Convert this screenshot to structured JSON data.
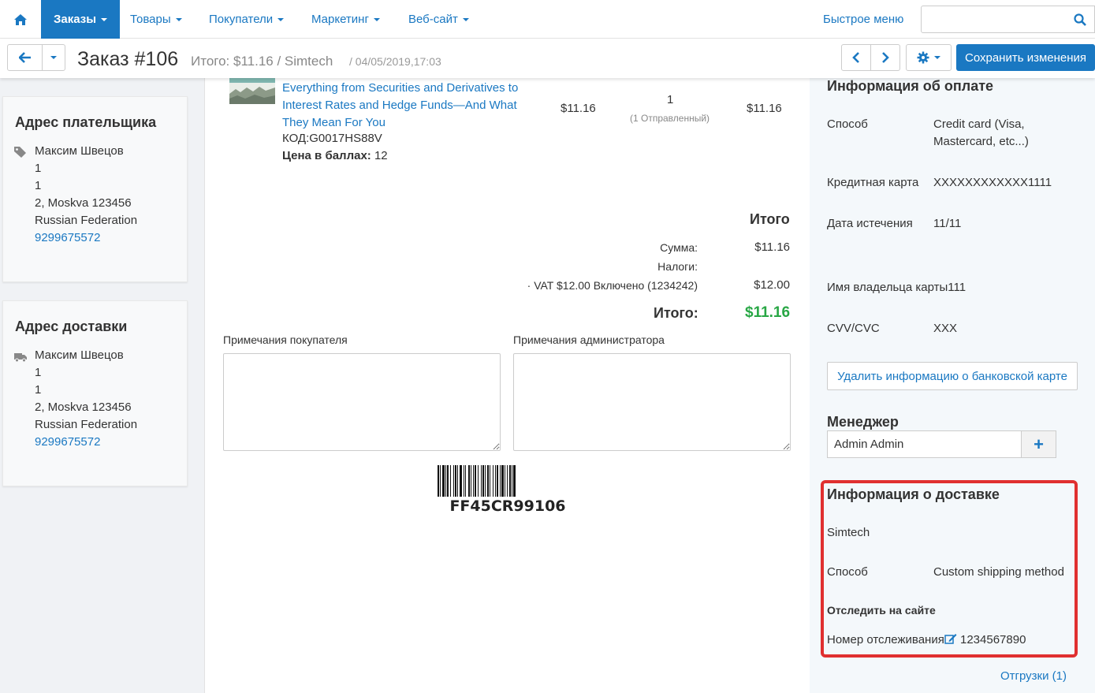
{
  "nav": {
    "items": [
      {
        "label": "Заказы"
      },
      {
        "label": "Товары"
      },
      {
        "label": "Покупатели"
      },
      {
        "label": "Маркетинг"
      },
      {
        "label": "Веб-сайт"
      }
    ],
    "quick_menu": "Быстрое меню",
    "search_placeholder": ""
  },
  "toolbar": {
    "title": "Заказ #106",
    "subtitle": "Итого: $11.16 / Simtech",
    "date": "/ 04/05/2019,17:03",
    "save_label": "Сохранить изменения"
  },
  "billing": {
    "title": "Адрес плательщика",
    "name": "Максим Швецов",
    "line1": "1",
    "line2": "1",
    "city": "2, Moskva 123456",
    "country": "Russian Federation",
    "phone": "9299675572"
  },
  "shipping_addr": {
    "title": "Адрес доставки",
    "name": "Максим Швецов",
    "line1": "1",
    "line2": "1",
    "city": "2, Moskva 123456",
    "country": "Russian Federation",
    "phone": "9299675572"
  },
  "product": {
    "name": "Everything from Securities and Derivatives to Interest Rates and Hedge Funds—And What They Mean For You",
    "code": "КОД:G0017HS88V",
    "points_label": "Цена в баллах:",
    "points_value": "12",
    "price": "$11.16",
    "qty": "1",
    "qty_status": "(1 Отправленный)",
    "total": "$11.16"
  },
  "totals": {
    "heading": "Итого",
    "subtotal_label": "Сумма:",
    "subtotal_value": "$11.16",
    "taxes_label": "Налоги:",
    "vat_label": "· VAT  $12.00  Включено (1234242)",
    "vat_value": "$12.00",
    "grand_label": "Итого:",
    "grand_value": "$11.16"
  },
  "notes": {
    "customer_label": "Примечания покупателя",
    "admin_label": "Примечания администратора",
    "customer_value": "",
    "admin_value": ""
  },
  "barcode": {
    "text": "FF45CR99106"
  },
  "payment": {
    "heading": "Информация об оплате",
    "method_label": "Способ",
    "method_value": "Credit card (Visa, Mastercard, etc...)",
    "card_label": "Кредитная карта",
    "card_value": "XXXXXXXXXXXX1111",
    "expiry_label": "Дата истечения",
    "expiry_value": "11/11",
    "holder_label": "Имя владельца карты",
    "holder_value": "111",
    "cvv_label": "CVV/CVC",
    "cvv_value": "XXX",
    "delete_button": "Удалить информацию о банковской карте"
  },
  "manager": {
    "heading": "Менеджер",
    "value": "Admin Admin",
    "add_symbol": "+"
  },
  "shipping_info": {
    "heading": "Информация о доставке",
    "company": "Simtech",
    "method_label": "Способ",
    "method_value": "Custom shipping method",
    "track_label": "Отследить на сайте",
    "tracking_label": "Номер отслеживания",
    "tracking_value": "1234567890",
    "shipments_link": "Отгрузки (1)"
  },
  "colors": {
    "accent": "#1a78c2",
    "highlight": "#e03030",
    "total_green": "#28a745"
  },
  "icons": [
    "home-icon",
    "search-icon",
    "arrow-left-icon",
    "arrow-right-icon",
    "chevron-left-icon",
    "gear-icon",
    "tag-icon",
    "truck-icon",
    "edit-icon",
    "plus-icon"
  ]
}
